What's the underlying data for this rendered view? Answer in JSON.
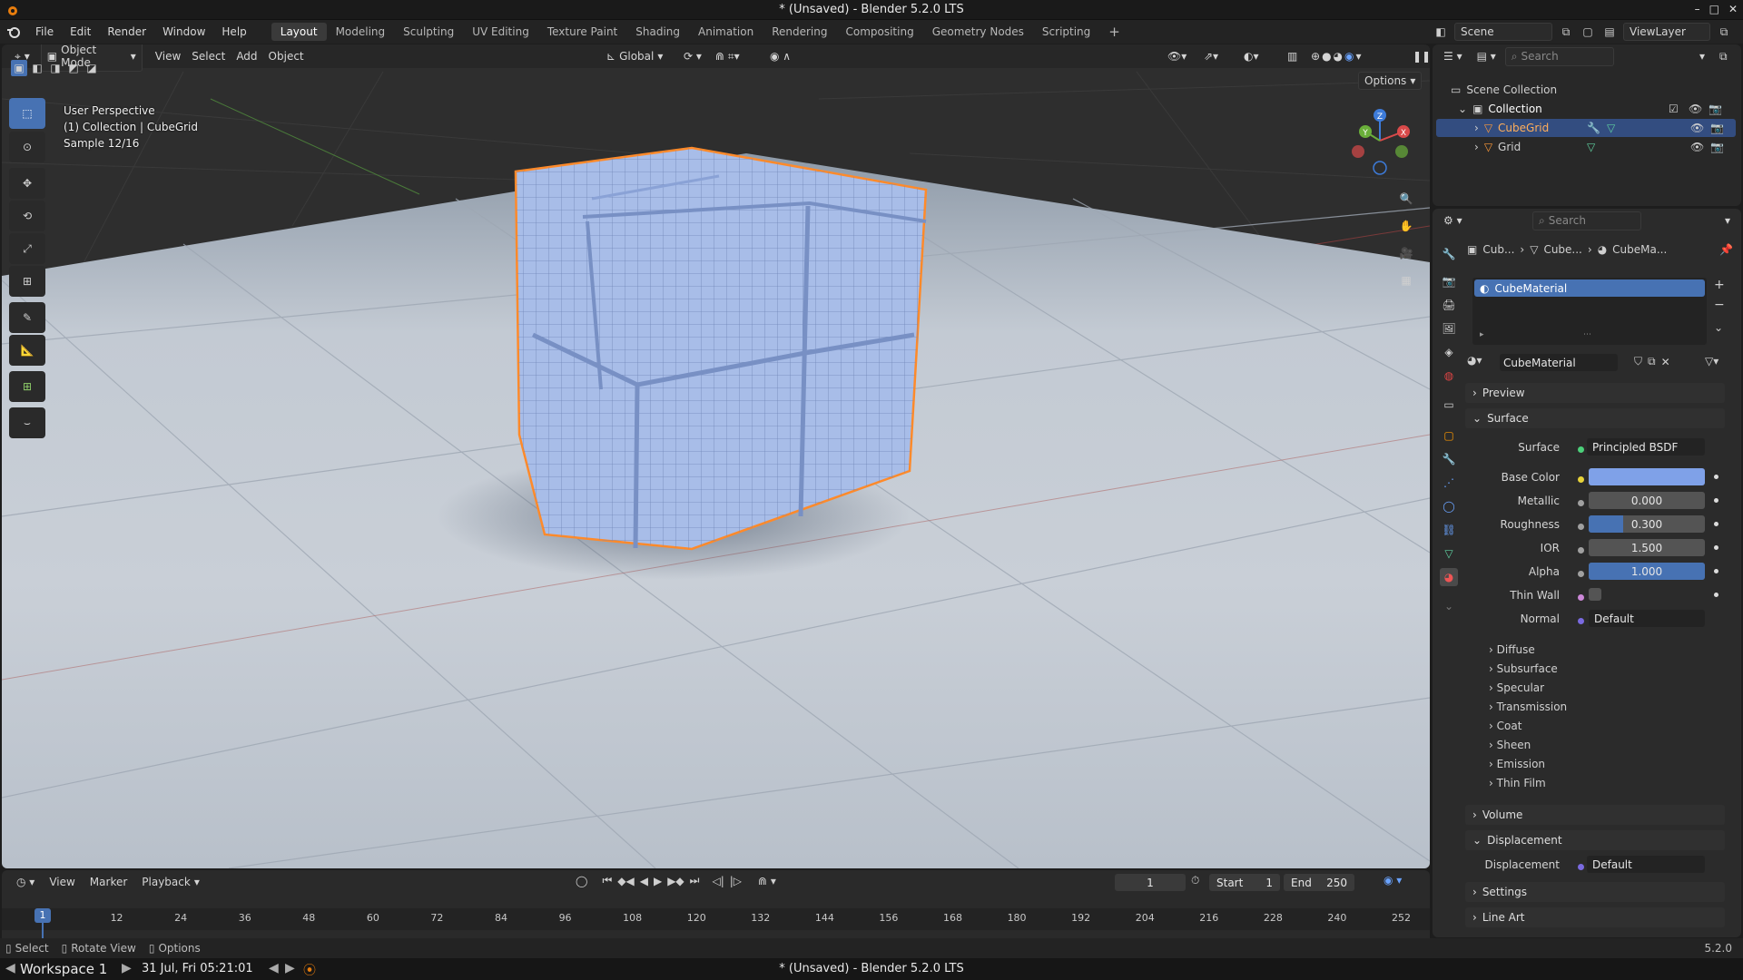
{
  "window": {
    "title": "* (Unsaved) - Blender 5.2.0 LTS",
    "controls": [
      "–",
      "□",
      "✕"
    ]
  },
  "menu": [
    "File",
    "Edit",
    "Render",
    "Window",
    "Help"
  ],
  "workspaces": [
    {
      "label": "Layout",
      "active": true
    },
    {
      "label": "Modeling"
    },
    {
      "label": "Sculpting"
    },
    {
      "label": "UV Editing"
    },
    {
      "label": "Texture Paint"
    },
    {
      "label": "Shading"
    },
    {
      "label": "Animation"
    },
    {
      "label": "Rendering"
    },
    {
      "label": "Compositing"
    },
    {
      "label": "Geometry Nodes"
    },
    {
      "label": "Scripting"
    }
  ],
  "top_right": {
    "scene": "Scene",
    "view_layer": "ViewLayer"
  },
  "viewport": {
    "mode": "Object Mode",
    "menus": [
      "View",
      "Select",
      "Add",
      "Object"
    ],
    "orientation": "Global",
    "options_label": "Options",
    "overlay_lines": [
      "User Perspective",
      "(1) Collection | CubeGrid",
      "Sample 12/16"
    ],
    "gizmo": {
      "x": "X",
      "y": "Y",
      "z": "Z"
    }
  },
  "outliner": {
    "search_placeholder": "Search",
    "scene_collection": "Scene Collection",
    "collection": "Collection",
    "objects": [
      {
        "name": "CubeGrid",
        "selected": true
      },
      {
        "name": "Grid",
        "selected": false
      }
    ]
  },
  "properties": {
    "search_placeholder": "Search",
    "breadcrumb": [
      "Cub...",
      "Cube...",
      "CubeMa..."
    ],
    "slot": "CubeMaterial",
    "material_name": "CubeMaterial",
    "panels": {
      "preview": "Preview",
      "surface": "Surface",
      "volume": "Volume",
      "displacement": "Displacement",
      "settings": "Settings",
      "line_art": "Line Art"
    },
    "surface_shader": {
      "label": "Surface",
      "value": "Principled BSDF"
    },
    "params": [
      {
        "label": "Base Color",
        "value": "",
        "color": "#7fa1e8",
        "kind": "color"
      },
      {
        "label": "Metallic",
        "value": "0.000",
        "fill": 0.0,
        "kind": "slider"
      },
      {
        "label": "Roughness",
        "value": "0.300",
        "fill": 0.3,
        "kind": "slider"
      },
      {
        "label": "IOR",
        "value": "1.500",
        "fill": 0.0,
        "kind": "slider"
      },
      {
        "label": "Alpha",
        "value": "1.000",
        "fill": 1.0,
        "kind": "slider"
      },
      {
        "label": "Thin Wall",
        "value": "",
        "kind": "checkbox"
      },
      {
        "label": "Normal",
        "value": "Default",
        "kind": "link"
      }
    ],
    "subpanels": [
      "Diffuse",
      "Subsurface",
      "Specular",
      "Transmission",
      "Coat",
      "Sheen",
      "Emission",
      "Thin Film"
    ],
    "displacement": {
      "label": "Displacement",
      "value": "Default"
    }
  },
  "timeline": {
    "menus": [
      "View",
      "Marker",
      "Playback"
    ],
    "current_frame": "1",
    "start_label": "Start",
    "start": "1",
    "end_label": "End",
    "end": "250",
    "ticks": [
      "1",
      "12",
      "24",
      "36",
      "48",
      "60",
      "72",
      "84",
      "96",
      "108",
      "120",
      "132",
      "144",
      "156",
      "168",
      "180",
      "192",
      "204",
      "216",
      "228",
      "240",
      "252"
    ]
  },
  "status": {
    "items": [
      "Select",
      "Rotate View",
      "Options"
    ],
    "version": "5.2.0"
  },
  "taskbar": {
    "workspace": "Workspace 1",
    "datetime": "31 Jul, Fri 05:21:01",
    "title": "* (Unsaved) - Blender 5.2.0 LTS"
  },
  "colors": {
    "accent": "#4772b3",
    "selection": "#ff8a2a",
    "cube": "#8fa9e4"
  }
}
